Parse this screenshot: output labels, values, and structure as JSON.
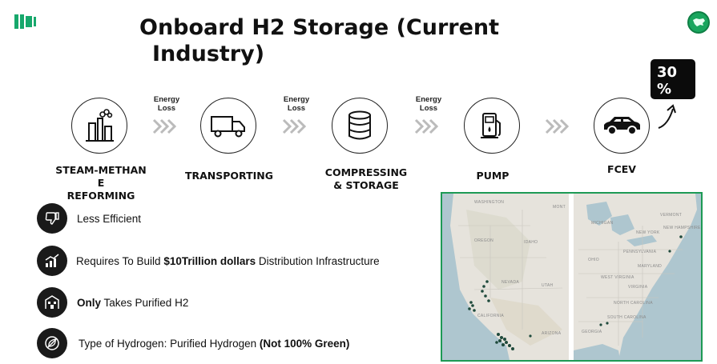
{
  "title": {
    "line1": "Onboard H2 Storage (Current",
    "line2": "Industry)"
  },
  "efficiency_badge": {
    "line1": "30",
    "line2": "%"
  },
  "steps": [
    {
      "label_lines": [
        "STEAM-METHAN",
        "E",
        "REFORMING"
      ],
      "icon": "factory-icon"
    },
    {
      "label_lines": [
        "TRANSPORTING"
      ],
      "icon": "truck-icon"
    },
    {
      "label_lines": [
        "COMPRESSING",
        "& STORAGE"
      ],
      "icon": "storage-tank-icon"
    },
    {
      "label_lines": [
        "PUMP"
      ],
      "icon": "fuel-pump-icon"
    },
    {
      "label_lines": [
        "FCEV"
      ],
      "icon": "car-icon"
    }
  ],
  "energy_loss": {
    "line1": "Energy",
    "line2": "Loss"
  },
  "features": [
    {
      "icon": "thumbs-down-icon",
      "pre": "Less Efficient",
      "bold": "",
      "post": ""
    },
    {
      "icon": "growth-chart-icon",
      "pre": "Requires To Build ",
      "bold": "$10Trillion dollars",
      "post": " Distribution Infrastructure"
    },
    {
      "icon": "building-icon",
      "pre": "",
      "bold": "Only",
      "post": " Takes Purified H2"
    },
    {
      "icon": "no-leaf-icon",
      "pre": "Type of Hydrogen: Purified Hydrogen ",
      "bold": "(Not 100% Green)",
      "post": ""
    }
  ],
  "map": {
    "labels_west": [
      "WASHINGTON",
      "MONT",
      "OREGON",
      "IDAHO",
      "NEVADA",
      "UTAH",
      "CALIFORNIA",
      "ARIZONA"
    ],
    "labels_east": [
      "MICHIGAN",
      "NEW YORK",
      "VERMONT",
      "NEW HAMPSHIRE",
      "PENNSYLVANIA",
      "OHIO",
      "MARYLAND",
      "WEST VIRGINIA",
      "VIRGINIA",
      "NORTH CAROLINA",
      "SOUTH CAROLINA",
      "GEORGIA"
    ]
  },
  "colors": {
    "accent": "#17a86c",
    "map_border": "#1d9a55",
    "dark": "#0b0b0b"
  }
}
